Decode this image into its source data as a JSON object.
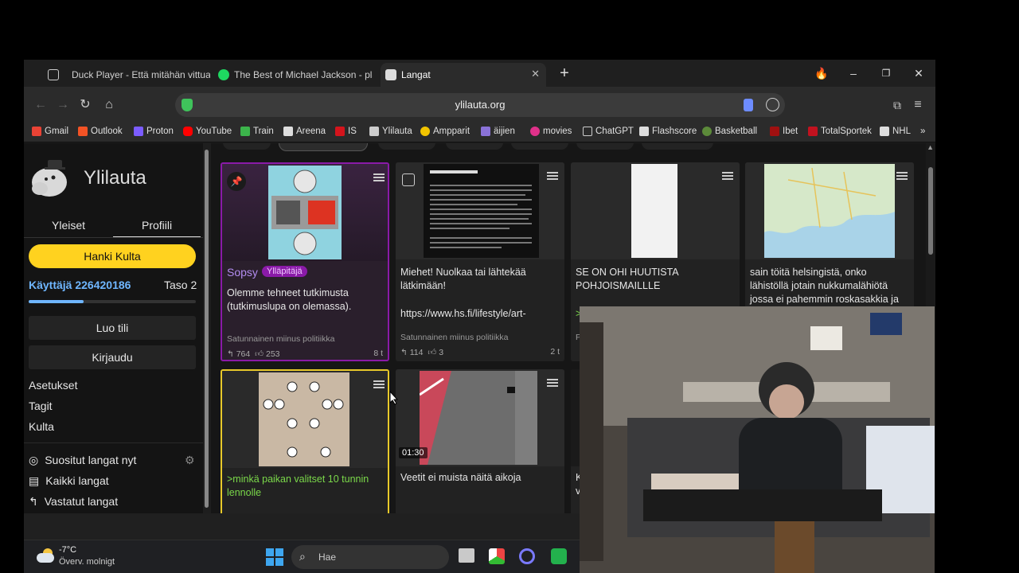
{
  "tabs": [
    {
      "label": "Duck Player - Että mitähän vittua"
    },
    {
      "label": "The Best of Michael Jackson - playl"
    },
    {
      "label": "Langat"
    }
  ],
  "address": {
    "url": "ylilauta.org"
  },
  "bookmarks": [
    "Gmail",
    "Outlook",
    "Proton",
    "YouTube",
    "Train",
    "Areena",
    "IS",
    "Ylilauta",
    "Ampparit",
    "äijien",
    "movies",
    "ChatGPT",
    "Flashscore",
    "Basketball",
    "Ibet",
    "TotalSportek",
    "NHL"
  ],
  "sidebar": {
    "site_title": "Ylilauta",
    "tabs": [
      "Yleiset",
      "Profiili"
    ],
    "gold_button": "Hanki Kulta",
    "user_name": "Käyttäjä 226420186",
    "user_level": "Taso 2",
    "level_progress": 0.33,
    "create_account": "Luo tili",
    "login": "Kirjaudu",
    "links": [
      "Asetukset",
      "Tagit",
      "Kulta"
    ],
    "nav": [
      "Suositut langat nyt",
      "Kaikki langat",
      "Vastatut langat"
    ]
  },
  "cards": [
    {
      "author": "Sopsy",
      "badge": "Ylläpitäjä",
      "title": "Olemme tehneet tutkimusta (tutkimuslupa on olemassa).",
      "board": "Satunnainen miinus politiikka",
      "replies": "764",
      "likes": "253",
      "age": "8 t"
    },
    {
      "title": "Miehet! Nuolkaa tai lähtekää lätkimään!",
      "link": "https://www.hs.fi/lifestyle/art-",
      "board": "Satunnainen miinus politiikka",
      "replies": "114",
      "likes": "3",
      "age": "2 t"
    },
    {
      "title": "SE ON OHI HUUTISTA POHJOISMAILLLE",
      "greentext": ">",
      "board": "P"
    },
    {
      "title": "sain töitä helsingistä, onko lähistöllä jotain nukkumalähiötä jossa ei pahemmin roskasakkia ja"
    },
    {
      "title": ">minkä paikan valitset 10 tunnin lennolle"
    },
    {
      "title": "Veetit ei muista näitä aikoja",
      "duration": "01:30"
    },
    {
      "title": "K v"
    }
  ],
  "taskbar": {
    "temperature": "-7°C",
    "weather": "Överv. molnigt",
    "search_placeholder": "Hae"
  },
  "colors": {
    "gold": "#ffd21f",
    "admin_purple": "#8a1aa8",
    "greentext": "#7bd94a",
    "user_blue": "#6fb6ff"
  }
}
